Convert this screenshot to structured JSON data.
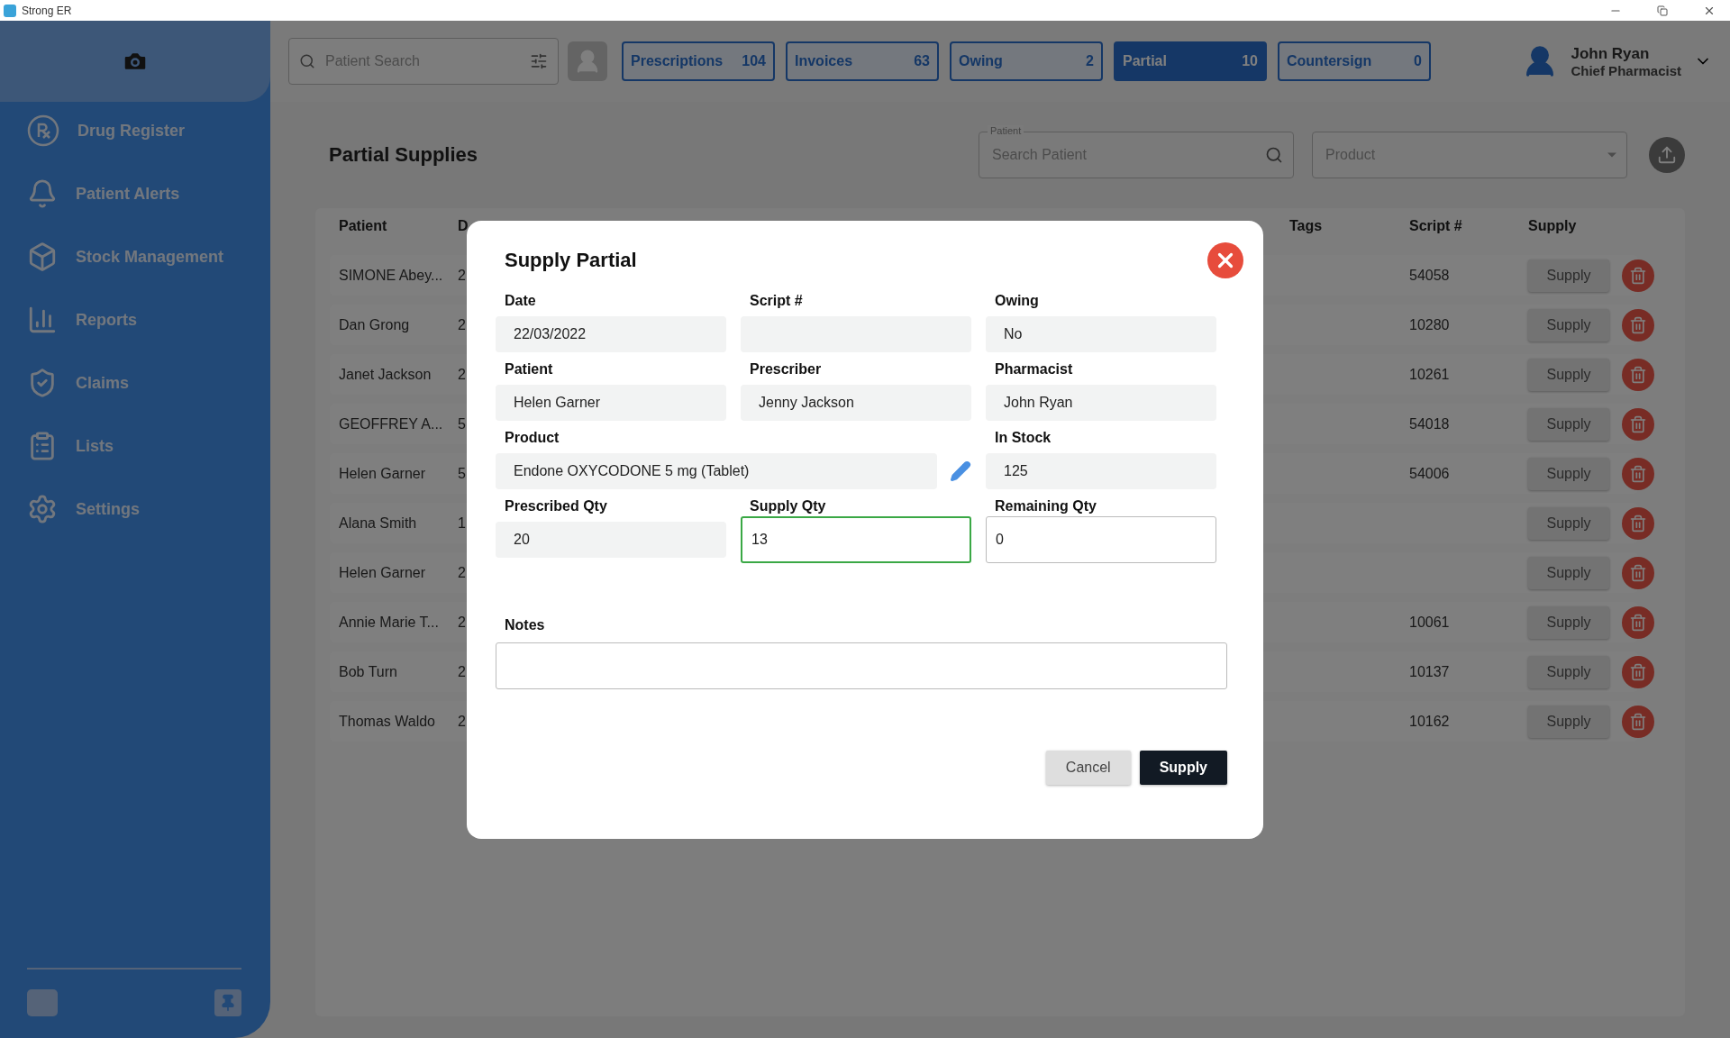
{
  "window": {
    "title": "Strong ER"
  },
  "sidebar": {
    "items": [
      {
        "label": "Drug Register"
      },
      {
        "label": "Patient Alerts"
      },
      {
        "label": "Stock Management"
      },
      {
        "label": "Reports"
      },
      {
        "label": "Claims"
      },
      {
        "label": "Lists"
      },
      {
        "label": "Settings"
      }
    ]
  },
  "search": {
    "placeholder": "Patient Search"
  },
  "tabs": [
    {
      "label": "Prescriptions",
      "count": "104",
      "selected": false
    },
    {
      "label": "Invoices",
      "count": "63",
      "selected": false
    },
    {
      "label": "Owing",
      "count": "2",
      "selected": false
    },
    {
      "label": "Partial",
      "count": "10",
      "selected": true
    },
    {
      "label": "Countersign",
      "count": "0",
      "selected": false
    }
  ],
  "user": {
    "name": "John Ryan",
    "role": "Chief Pharmacist"
  },
  "page": {
    "title": "Partial Supplies",
    "patient_filter": {
      "label": "Patient",
      "placeholder": "Search Patient"
    },
    "product_filter": {
      "placeholder": "Product"
    }
  },
  "table": {
    "columns": [
      "Patient",
      "D",
      "Tags",
      "Script #",
      "Supply"
    ],
    "rows": [
      {
        "patient": "SIMONE Abey...",
        "column_2": "2",
        "script": "54058",
        "action": "Supply"
      },
      {
        "patient": "Dan Grong",
        "column_2": "2",
        "script": "10280",
        "action": "Supply"
      },
      {
        "patient": "Janet Jackson",
        "column_2": "2",
        "script": "10261",
        "action": "Supply"
      },
      {
        "patient": "GEOFFREY A...",
        "column_2": "5",
        "script": "54018",
        "action": "Supply"
      },
      {
        "patient": "Helen Garner",
        "column_2": "5",
        "script": "54006",
        "action": "Supply"
      },
      {
        "patient": "Alana Smith",
        "column_2": "1",
        "script": "",
        "action": "Supply"
      },
      {
        "patient": "Helen Garner",
        "column_2": "2",
        "script": "",
        "action": "Supply"
      },
      {
        "patient": "Annie Marie T...",
        "column_2": "2",
        "script": "10061",
        "action": "Supply"
      },
      {
        "patient": "Bob Turn",
        "column_2": "2",
        "script": "10137",
        "action": "Supply"
      },
      {
        "patient": "Thomas Waldo",
        "column_2": "2",
        "script": "10162",
        "action": "Supply"
      }
    ]
  },
  "dialog": {
    "title": "Supply Partial",
    "fields": [
      {
        "label": "Date",
        "value": "22/03/2022",
        "kind": "readonly"
      },
      {
        "label": "Script #",
        "kind": "readonly"
      },
      {
        "label": "Owing",
        "value": "No",
        "kind": "readonly"
      },
      {
        "label": "Patient",
        "value": "Helen Garner",
        "kind": "readonly"
      },
      {
        "label": "Prescriber",
        "value": "Jenny Jackson",
        "kind": "readonly"
      },
      {
        "label": "Pharmacist",
        "value": "John Ryan",
        "kind": "readonly"
      },
      {
        "label": "Product",
        "value": "Endone OXYCODONE 5 mg (Tablet)",
        "kind": "wide"
      },
      {
        "label": "In Stock",
        "value": "125",
        "kind": "readonly"
      },
      {
        "label": "Prescribed Qty",
        "value": "20",
        "kind": "readonly"
      },
      {
        "label": "Supply Qty",
        "value": "13",
        "kind": "input",
        "focused": true
      },
      {
        "label": "Remaining Qty",
        "value": "0",
        "kind": "input",
        "focused": false
      }
    ],
    "notes": {
      "label": "Notes"
    },
    "buttons": [
      {
        "label": "Cancel",
        "kind": "secondary"
      },
      {
        "label": "Supply",
        "kind": "primary"
      }
    ]
  }
}
